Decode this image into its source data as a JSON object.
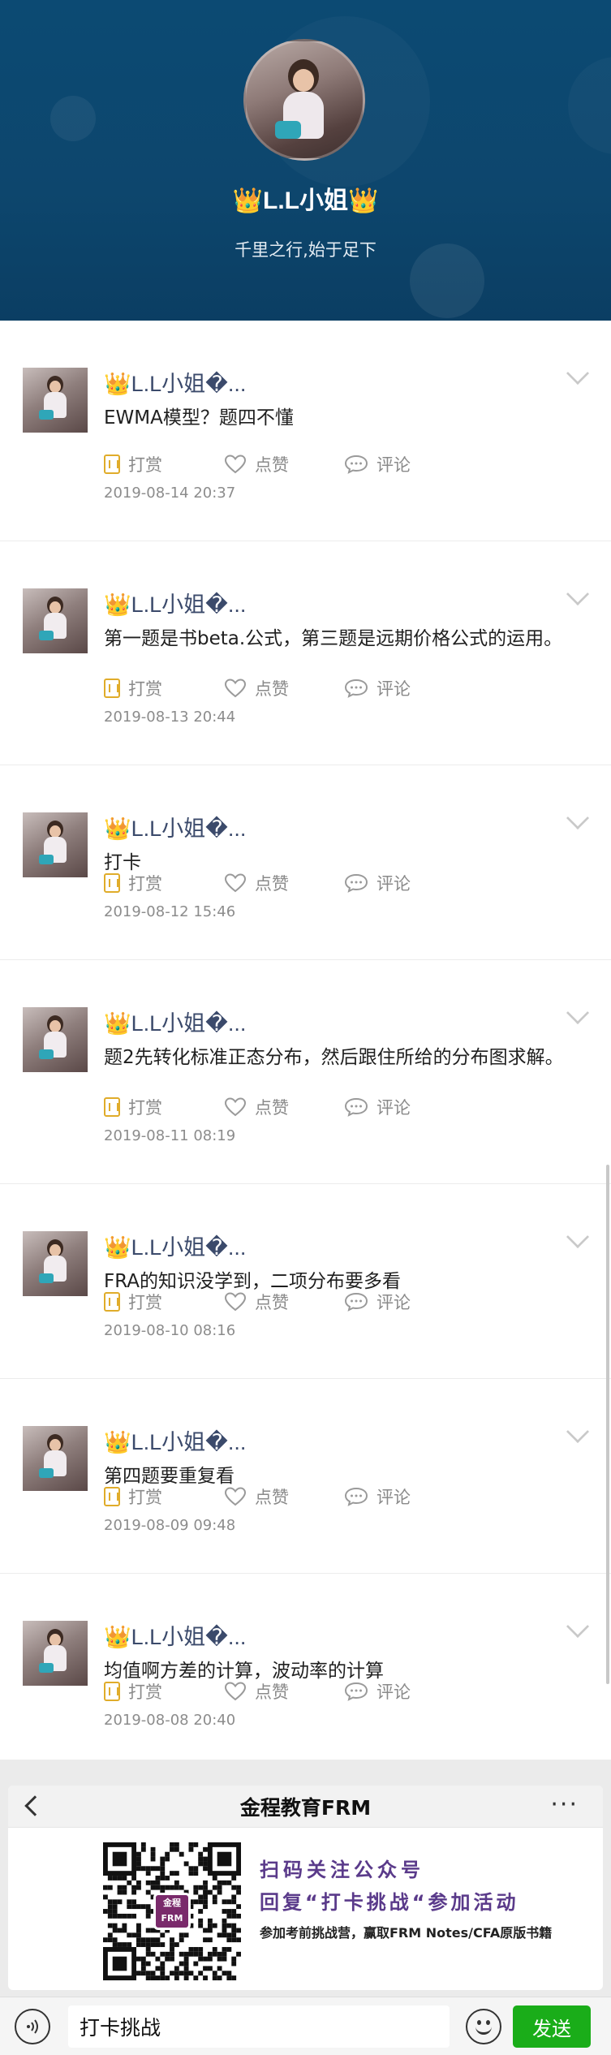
{
  "profile": {
    "name": "L.L小姐",
    "bio": "千里之行,始于足下",
    "crown_glyph": "👑"
  },
  "posts": [
    {
      "name": "L.L小姐�...",
      "text": "EWMA模型？题四不懂",
      "reward": "打赏",
      "like": "点赞",
      "comment": "评论",
      "time": "2019-08-14 20:37"
    },
    {
      "name": "L.L小姐�...",
      "text": "第一题是书beta.公式，第三题是远期价格公式的运用。",
      "reward": "打赏",
      "like": "点赞",
      "comment": "评论",
      "time": "2019-08-13 20:44"
    },
    {
      "name": "L.L小姐�...",
      "text": "打卡",
      "reward": "打赏",
      "like": "点赞",
      "comment": "评论",
      "time": "2019-08-12 15:46"
    },
    {
      "name": "L.L小姐�...",
      "text": "题2先转化标准正态分布，然后跟住所给的分布图求解。",
      "reward": "打赏",
      "like": "点赞",
      "comment": "评论",
      "time": "2019-08-11 08:19"
    },
    {
      "name": "L.L小姐�...",
      "text": "FRA的知识没学到，二项分布要多看",
      "reward": "打赏",
      "like": "点赞",
      "comment": "评论",
      "time": "2019-08-10 08:16"
    },
    {
      "name": "L.L小姐�...",
      "text": "第四题要重复看",
      "reward": "打赏",
      "like": "点赞",
      "comment": "评论",
      "time": "2019-08-09 09:48"
    },
    {
      "name": "L.L小姐�...",
      "text": "均值啊方差的计算，波动率的计算",
      "reward": "打赏",
      "like": "点赞",
      "comment": "评论",
      "time": "2019-08-08 20:40"
    }
  ],
  "card": {
    "title": "金程教育FRM",
    "more": "···",
    "qr_logo_line1": "金程",
    "qr_logo_line2": "FRM",
    "promo_line1": "扫码关注公众号",
    "promo_line2": "回复“打卡挑战“参加活动",
    "promo_line3": "参加考前挑战营，赢取FRM Notes/CFA原版书籍"
  },
  "input_bar": {
    "voice_icon": "voice-icon",
    "value": "打卡挑战",
    "send_label": "发送"
  },
  "colors": {
    "header_bg": "#0d466d",
    "name_link": "#3b4a6b",
    "reward_gold": "#e0ac2a",
    "send_green": "#1aad19",
    "promo_purple": "#5a3a8a"
  }
}
